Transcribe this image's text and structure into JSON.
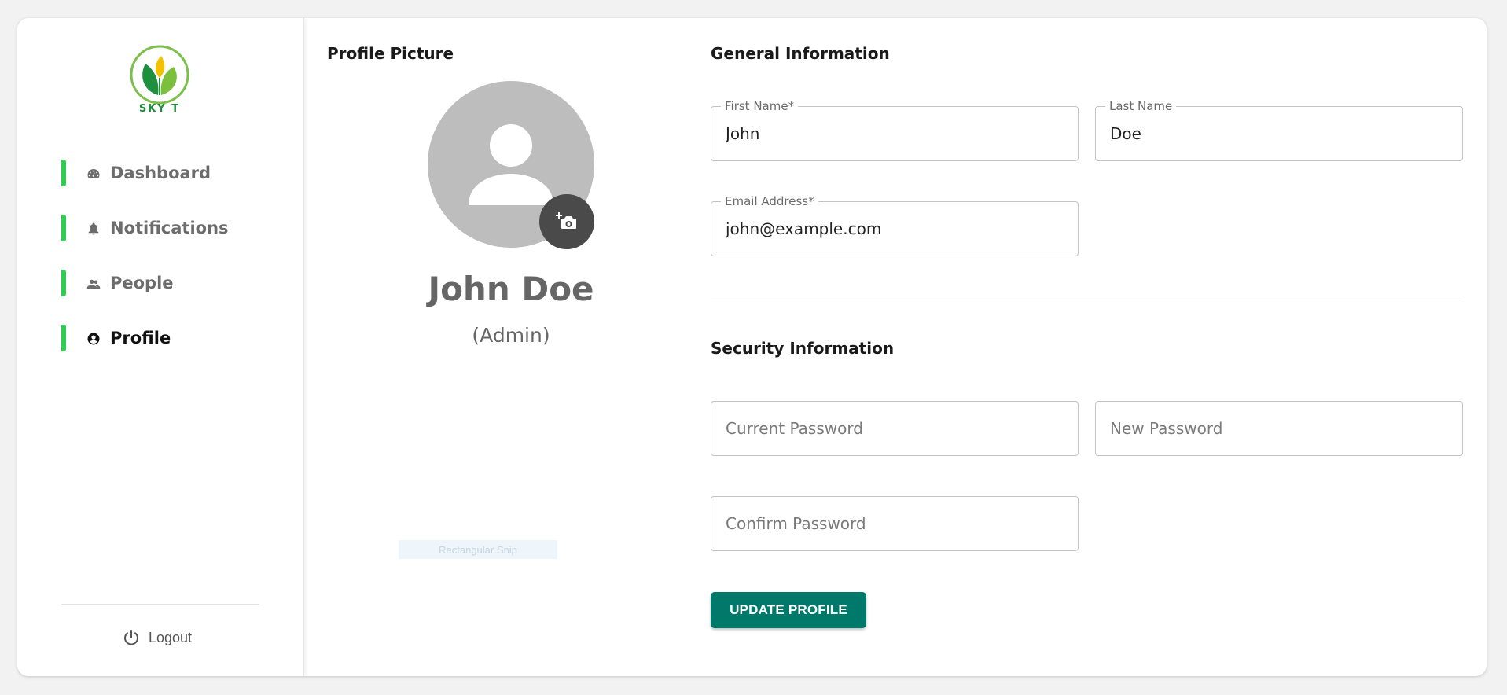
{
  "brand": {
    "name": "SKY T",
    "accent": "#2ecc50",
    "brand_green": "#1f8a3a"
  },
  "sidebar": {
    "items": [
      {
        "label": "Dashboard",
        "icon": "dashboard-gauge-icon",
        "active": false
      },
      {
        "label": "Notifications",
        "icon": "bell-icon",
        "active": false
      },
      {
        "label": "People",
        "icon": "people-icon",
        "active": false
      },
      {
        "label": "Profile",
        "icon": "account-circle-icon",
        "active": true
      }
    ],
    "logout_label": "Logout"
  },
  "profile_picture": {
    "title": "Profile Picture",
    "name": "John Doe",
    "role": "(Admin)",
    "snip_text": "Rectangular Snip"
  },
  "general": {
    "title": "General Information",
    "first_name": {
      "label": "First Name*",
      "value": "John"
    },
    "last_name": {
      "label": "Last Name",
      "value": "Doe"
    },
    "email": {
      "label": "Email Address*",
      "value": "john@example.com"
    }
  },
  "security": {
    "title": "Security Information",
    "current_password": {
      "placeholder": "Current Password"
    },
    "new_password": {
      "placeholder": "New Password"
    },
    "confirm_password": {
      "placeholder": "Confirm Password"
    }
  },
  "actions": {
    "update_label": "UPDATE PROFILE",
    "button_color": "#00796b"
  }
}
